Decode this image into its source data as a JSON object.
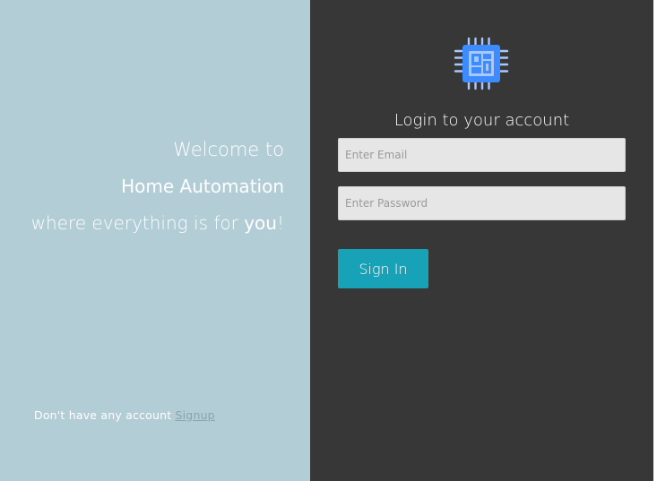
{
  "welcome": {
    "line1": "Welcome to",
    "line2": "Home Automation",
    "line3_prefix": "where everything is for ",
    "line3_emphasis": "you",
    "line3_suffix": "!"
  },
  "signup": {
    "prompt": "Don't have any account",
    "link_label": "Signup"
  },
  "login": {
    "title": "Login to your account",
    "email_placeholder": "Enter Email",
    "password_placeholder": "Enter Password",
    "submit_label": "Sign In"
  },
  "icons": {
    "logo": "chip-icon"
  },
  "colors": {
    "left_panel_bg": "#b3cdd7",
    "right_panel_bg": "#373737",
    "accent": "#17a2b8",
    "logo_blue": "#3d8bfd",
    "logo_light": "#a8c8ff"
  }
}
